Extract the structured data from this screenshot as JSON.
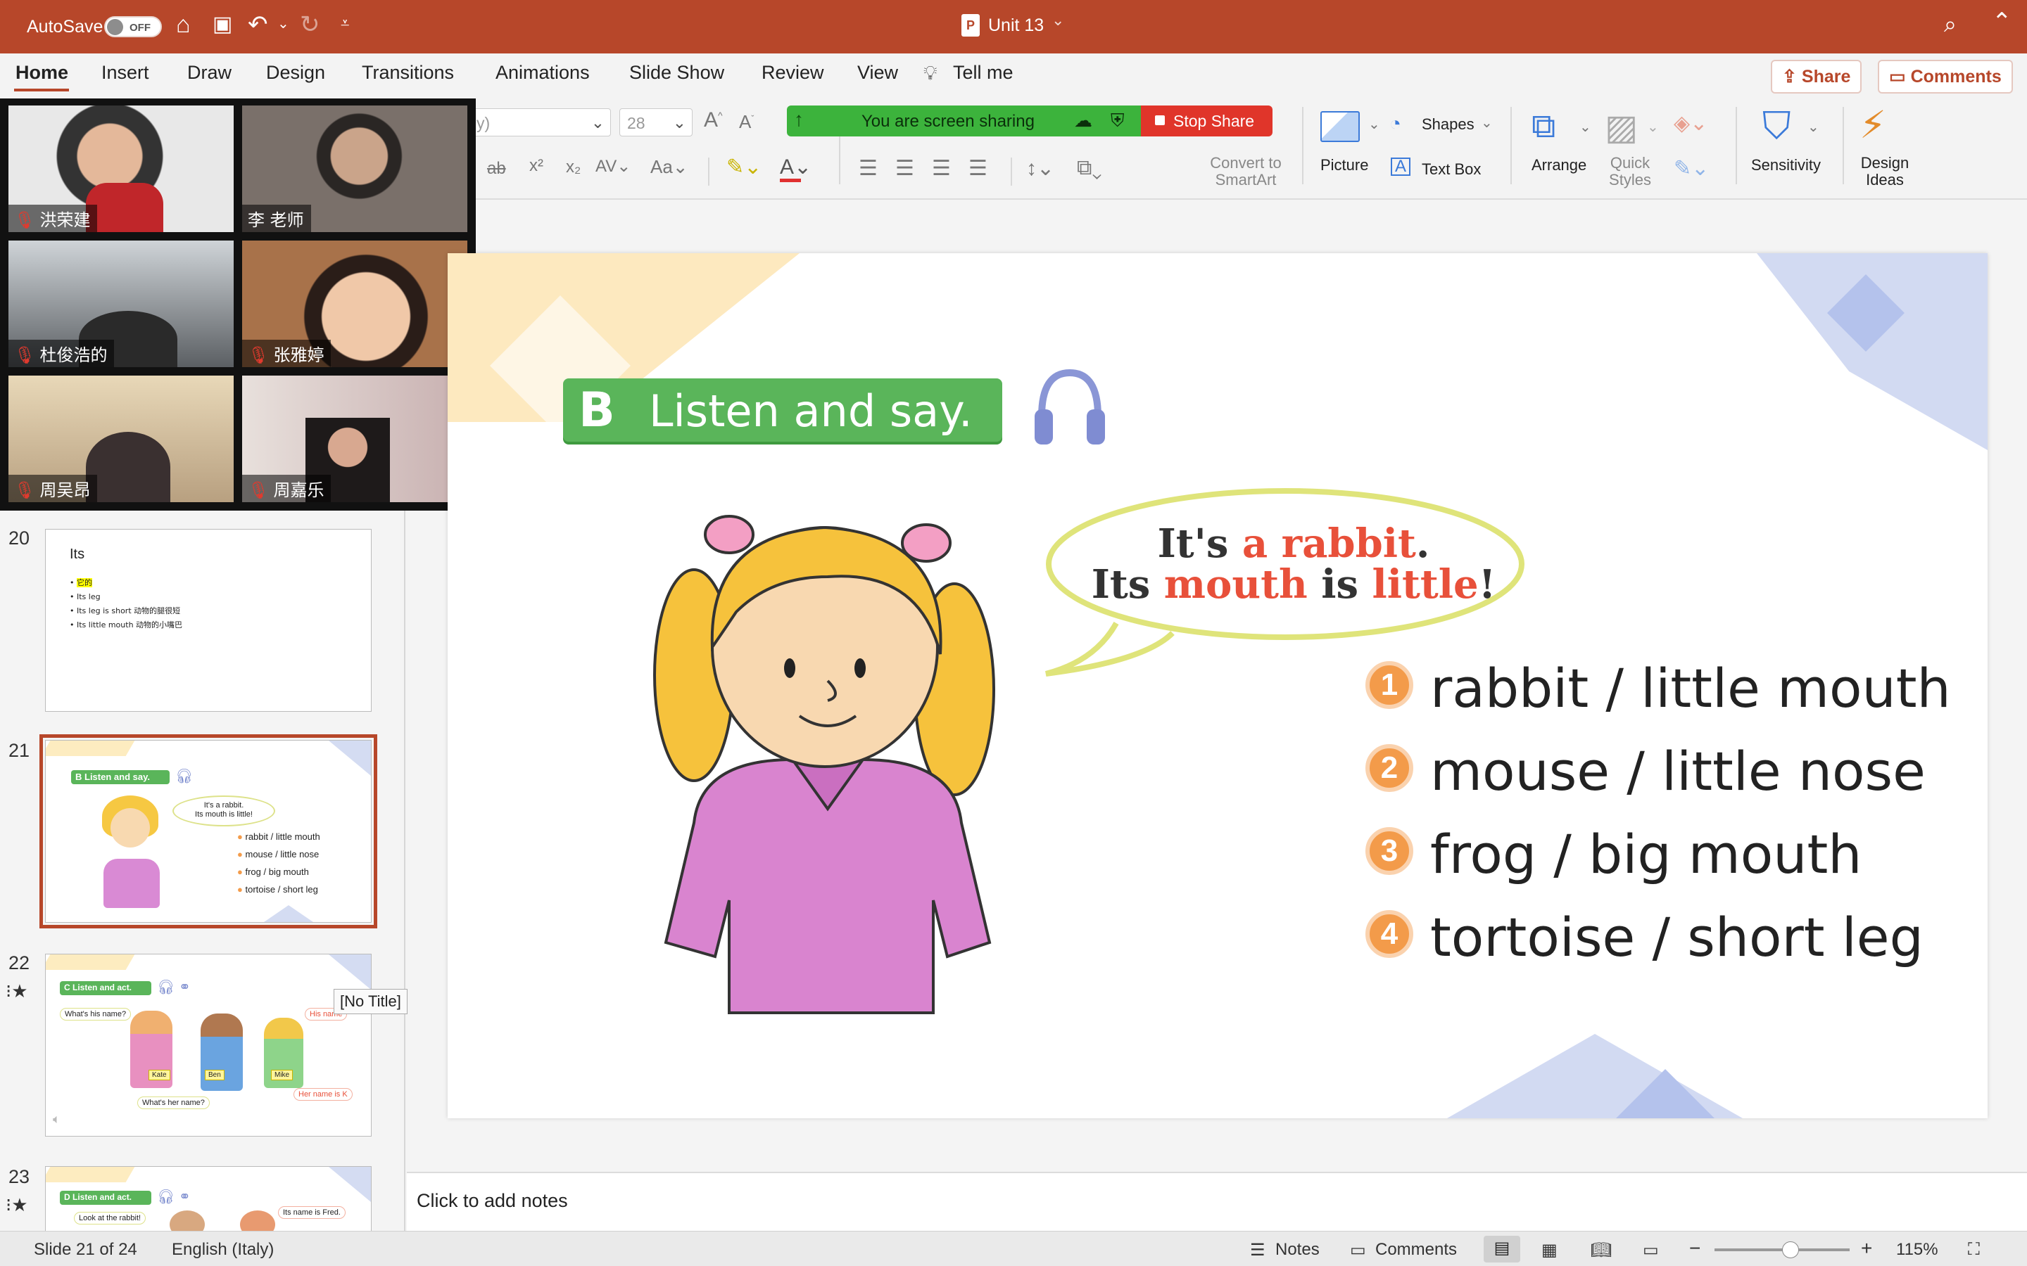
{
  "titlebar": {
    "autosave_label": "AutoSave",
    "autosave_state": "OFF",
    "doc_title": "Unit 13",
    "doc_chevron": "⌄"
  },
  "tabs": [
    "Home",
    "Insert",
    "Draw",
    "Design",
    "Transitions",
    "Animations",
    "Slide Show",
    "Review",
    "View",
    "Tell me"
  ],
  "active_tab": "Home",
  "actions": {
    "share": "Share",
    "comments": "Comments"
  },
  "ribbon": {
    "font_name": "y)",
    "font_size": "28",
    "convert_smartart": [
      "Convert to",
      "SmartArt"
    ],
    "picture": "Picture",
    "shapes": "Shapes",
    "text_box": "Text Box",
    "arrange": "Arrange",
    "quick_styles": [
      "Quick",
      "Styles"
    ],
    "sensitivity": "Sensitivity",
    "design_ideas": [
      "Design",
      "Ideas"
    ]
  },
  "screenshare": {
    "status": "You are screen sharing",
    "stop": "Stop Share"
  },
  "participants": [
    {
      "name": "洪荣建",
      "muted": true
    },
    {
      "name": "李 老师",
      "muted": false
    },
    {
      "name": "杜俊浩的",
      "muted": true
    },
    {
      "name": "张雅婷",
      "muted": true
    },
    {
      "name": "周吴昂",
      "muted": true
    },
    {
      "name": "周嘉乐",
      "muted": true
    }
  ],
  "thumbnails": {
    "s20": {
      "number": "20",
      "title": "Its",
      "bullets": [
        "它的",
        "Its leg",
        "Its leg is short 动物的腿很短",
        "Its little mouth 动物的小嘴巴"
      ]
    },
    "s21": {
      "number": "21",
      "header": "Listen and say.",
      "bubble1": "It's a rabbit.",
      "bubble2": "Its mouth is little!",
      "items": [
        "rabbit / little mouth",
        "mouse / little nose",
        "frog / big mouth",
        "tortoise / short leg"
      ]
    },
    "s22": {
      "number": "22",
      "header": "Listen and act.",
      "q1": "What's his name?",
      "q2": "What's her name?",
      "a1": "His name",
      "a2": "Her name is K",
      "tags": [
        "Kate",
        "Ben",
        "Mike"
      ]
    },
    "s23": {
      "number": "23",
      "header": "Listen and act.",
      "q1": "Look at the rabbit!",
      "a1": "Its name is Fred."
    }
  },
  "tooltip": "[No Title]",
  "slide": {
    "letter": "B",
    "header": "Listen and say.",
    "bubble_line1": [
      "It's ",
      "a rabbit",
      "."
    ],
    "bubble_line2": [
      "Its ",
      "mouth",
      " is ",
      "little",
      "!"
    ],
    "items": [
      {
        "n": "1",
        "text": "rabbit / little mouth"
      },
      {
        "n": "2",
        "text": "mouse / little nose"
      },
      {
        "n": "3",
        "text": "frog / big mouth"
      },
      {
        "n": "4",
        "text": "tortoise / short leg"
      }
    ]
  },
  "notes_placeholder": "Click to add notes",
  "status": {
    "slide_of": "Slide 21 of 24",
    "language": "English (Italy)",
    "notes": "Notes",
    "comments": "Comments",
    "zoom": "115%"
  },
  "colors": {
    "brand": "#b7472a",
    "share_green": "#3cb33c",
    "share_red": "#e0352a",
    "header_green": "#5ab55a",
    "accent_red": "#e8503a",
    "orange": "#f39b4a"
  }
}
